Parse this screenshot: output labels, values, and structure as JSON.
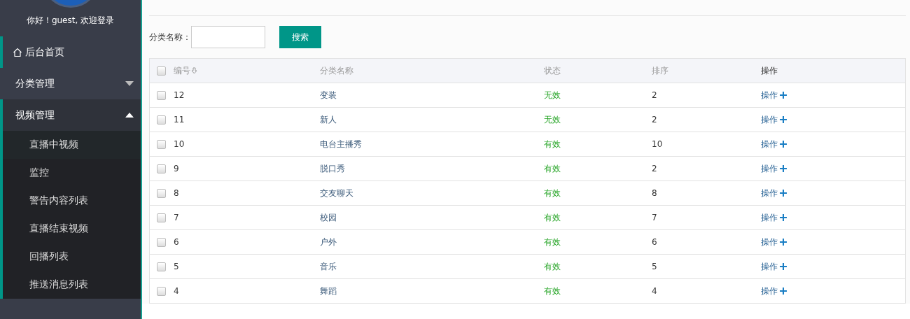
{
  "sidebar": {
    "greeting": "你好！guest, 欢迎登录",
    "items": [
      {
        "kind": "link",
        "label": "后台首页",
        "selected": true
      },
      {
        "kind": "group",
        "label": "分类管理",
        "expanded": false
      },
      {
        "kind": "group",
        "label": "视频管理",
        "expanded": true,
        "children": [
          {
            "label": "直播中视频",
            "selected": true
          },
          {
            "label": "监控",
            "selected": false
          },
          {
            "label": "警告内容列表",
            "selected": false
          },
          {
            "label": "直播结束视频",
            "selected": false
          },
          {
            "label": "回播列表",
            "selected": false
          },
          {
            "label": "推送消息列表",
            "selected": false
          }
        ]
      }
    ]
  },
  "search": {
    "label": "分类名称：",
    "button": "搜索"
  },
  "table": {
    "select_all_checked": false,
    "columns": [
      "编号",
      "分类名称",
      "状态",
      "排序",
      "操作"
    ],
    "rows": [
      {
        "checked": false,
        "id": "12",
        "name": "变装",
        "status": "无效",
        "order": "2",
        "action": "操作"
      },
      {
        "checked": false,
        "id": "11",
        "name": "新人",
        "status": "无效",
        "order": "2",
        "action": "操作"
      },
      {
        "checked": false,
        "id": "10",
        "name": "电台主播秀",
        "status": "有效",
        "order": "10",
        "action": "操作"
      },
      {
        "checked": false,
        "id": "9",
        "name": "脱口秀",
        "status": "有效",
        "order": "2",
        "action": "操作"
      },
      {
        "checked": false,
        "id": "8",
        "name": "交友聊天",
        "status": "有效",
        "order": "8",
        "action": "操作"
      },
      {
        "checked": false,
        "id": "7",
        "name": "校园",
        "status": "有效",
        "order": "7",
        "action": "操作"
      },
      {
        "checked": false,
        "id": "6",
        "name": "户外",
        "status": "有效",
        "order": "6",
        "action": "操作"
      },
      {
        "checked": false,
        "id": "5",
        "name": "音乐",
        "status": "有效",
        "order": "5",
        "action": "操作"
      },
      {
        "checked": false,
        "id": "4",
        "name": "舞蹈",
        "status": "有效",
        "order": "4",
        "action": "操作"
      }
    ]
  }
}
